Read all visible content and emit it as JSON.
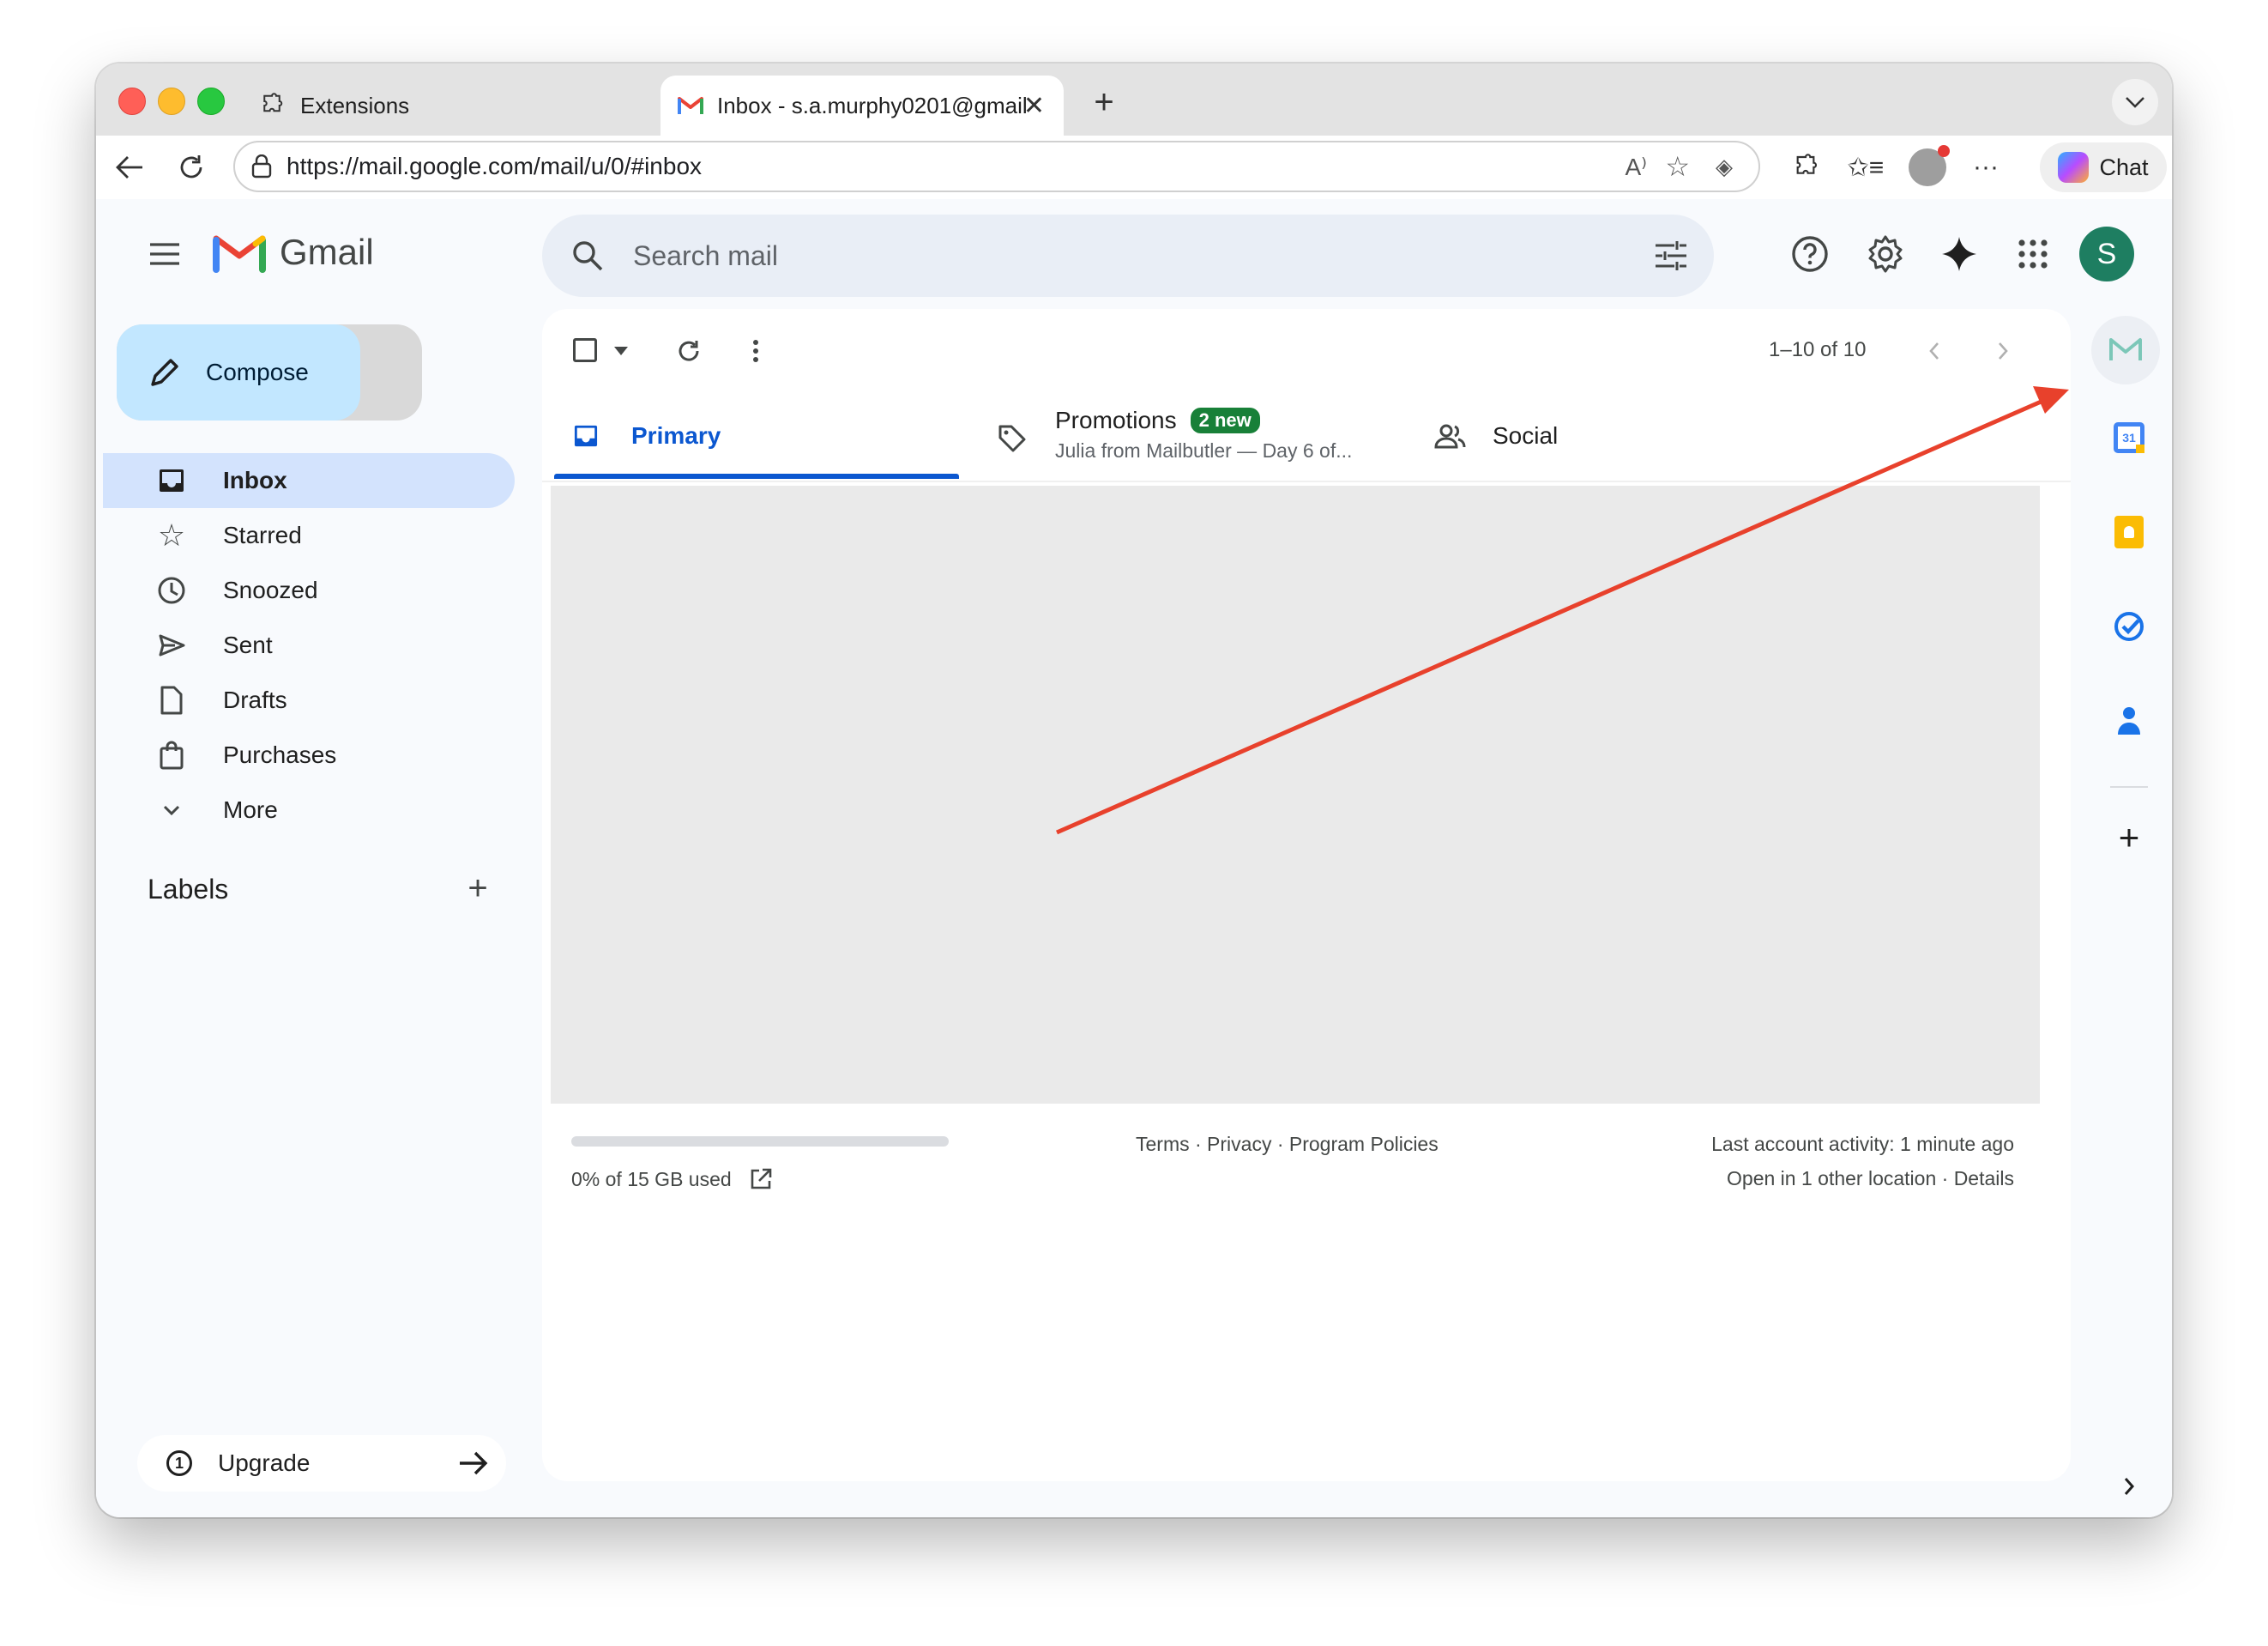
{
  "browser": {
    "tabs": [
      {
        "title": "Extensions",
        "icon": "puzzle-icon"
      },
      {
        "title": "Inbox - s.a.murphy0201@gmail.",
        "icon": "gmail-icon"
      }
    ],
    "url": "https://mail.google.com/mail/u/0/#inbox",
    "chat_label": "Chat"
  },
  "gmail": {
    "logo_text": "Gmail",
    "search_placeholder": "Search mail",
    "avatar_letter": "S",
    "compose_label": "Compose",
    "nav": [
      {
        "label": "Inbox",
        "icon": "inbox-icon",
        "active": true
      },
      {
        "label": "Starred",
        "icon": "star-icon"
      },
      {
        "label": "Snoozed",
        "icon": "clock-icon"
      },
      {
        "label": "Sent",
        "icon": "send-icon"
      },
      {
        "label": "Drafts",
        "icon": "draft-icon"
      },
      {
        "label": "Purchases",
        "icon": "shopping-bag-icon"
      },
      {
        "label": "More",
        "icon": "chevron-down-icon"
      }
    ],
    "labels_heading": "Labels",
    "upgrade_label": "Upgrade",
    "pagination": "1–10 of 10",
    "tabs": {
      "primary": "Primary",
      "promotions": "Promotions",
      "promotions_badge": "2 new",
      "promotions_snippet": "Julia from Mailbutler — Day 6 of...",
      "social": "Social"
    },
    "footer": {
      "storage": "0% of 15 GB used",
      "storage_fraction": 0.0,
      "links": "Terms · Privacy · Program Policies",
      "activity": "Last account activity: 1 minute ago",
      "location": "Open in 1 other location · Details"
    }
  },
  "colors": {
    "accent_blue": "#0b57d0",
    "nav_active_bg": "#d3e3fd",
    "compose_bg": "#c2e7ff",
    "annotation_arrow": "#e8412c",
    "badge_green": "#188038",
    "avatar_green": "#1e7e61"
  }
}
